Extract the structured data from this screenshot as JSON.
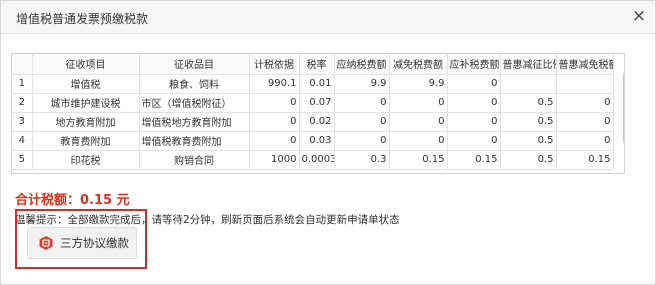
{
  "dialog": {
    "title": "增值税普通发票预缴税款",
    "close_label": "×"
  },
  "table": {
    "columns": [
      "",
      "征收项目",
      "征收品目",
      "计税依据",
      "税率",
      "应纳税费额",
      "减免税费额",
      "应补税费额",
      "普惠减征比例",
      "普惠减免税额"
    ],
    "rows": [
      [
        "1",
        "增值税",
        "粮食、饲料",
        "990.1",
        "0.01",
        "9.9",
        "9.9",
        "0",
        "",
        ""
      ],
      [
        "2",
        "城市维护建设税",
        "市区（增值税附征）",
        "0",
        "0.07",
        "0",
        "0",
        "0",
        "0.5",
        "0"
      ],
      [
        "3",
        "地方教育附加",
        "增值税地方教育附加",
        "0",
        "0.02",
        "0",
        "0",
        "0",
        "0.5",
        "0"
      ],
      [
        "4",
        "教育费附加",
        "增值税教育费附加",
        "0",
        "0.03",
        "0",
        "0",
        "0",
        "0.5",
        "0"
      ],
      [
        "5",
        "印花税",
        "购销合同",
        "1000",
        "0.0003",
        "0.3",
        "0.15",
        "0.15",
        "0.5",
        "0.15"
      ]
    ]
  },
  "total": {
    "text": "合计税额：0.15 元"
  },
  "hint": {
    "text": "温馨提示：全部缴款完成后，请等待2分钟，刷新页面后系统会自动更新申请单状态"
  },
  "pay_button": {
    "label": "三方协议缴款",
    "icon": "tax-payment-icon"
  },
  "colors": {
    "accent_red": "#d92a2a",
    "icon_red": "#e5392d"
  }
}
